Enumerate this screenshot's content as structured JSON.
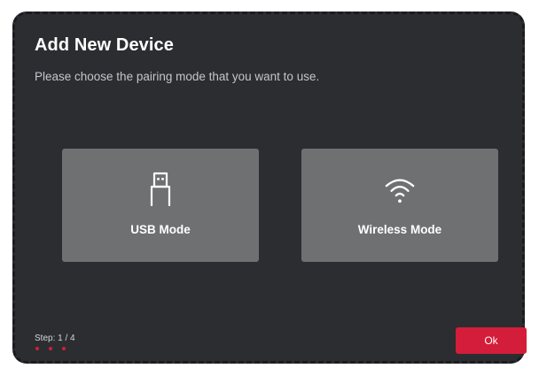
{
  "dialog": {
    "title": "Add New Device",
    "subtitle": "Please choose the pairing mode that you want to use."
  },
  "modes": [
    {
      "label": "USB Mode",
      "icon": "usb-plug-icon"
    },
    {
      "label": "Wireless Mode",
      "icon": "wifi-icon"
    }
  ],
  "footer": {
    "step_text": "Step: 1 / 4",
    "current_step": 1,
    "total_steps": 4,
    "dots_shown": 3,
    "ok_label": "Ok"
  },
  "colors": {
    "dialog_background": "#2b2d31",
    "card_background": "#6e7072",
    "accent": "#d41d3a",
    "text_primary": "#ffffff",
    "text_secondary": "#c4c6cb"
  }
}
